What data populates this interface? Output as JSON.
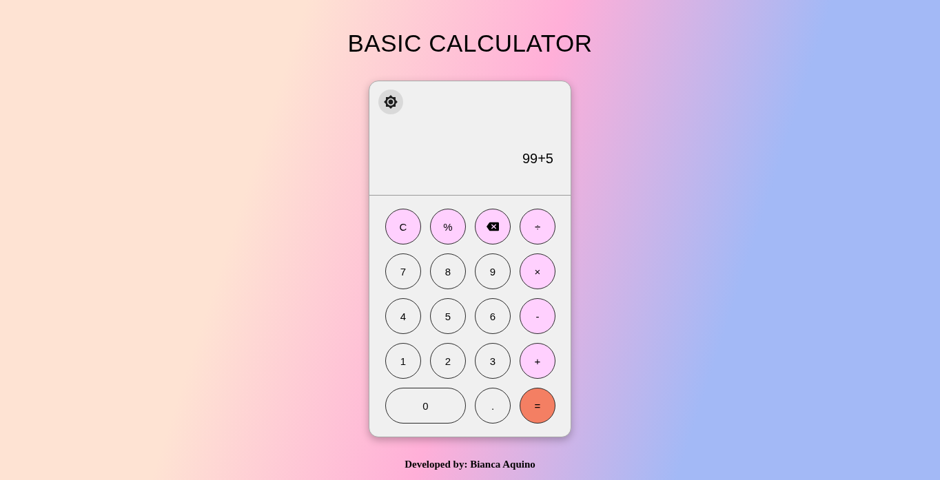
{
  "title": "BASIC CALCULATOR",
  "calculator": {
    "display": {
      "expression": "99+5"
    },
    "keys": [
      {
        "kind": "function",
        "label": "C",
        "wide": false
      },
      {
        "kind": "function",
        "label": "%",
        "wide": false
      },
      {
        "kind": "backspace",
        "wide": false
      },
      {
        "kind": "operator",
        "label": "÷",
        "wide": false
      },
      {
        "kind": "digit",
        "label": "7",
        "wide": false
      },
      {
        "kind": "digit",
        "label": "8",
        "wide": false
      },
      {
        "kind": "digit",
        "label": "9",
        "wide": false
      },
      {
        "kind": "operator",
        "label": "×",
        "wide": false
      },
      {
        "kind": "digit",
        "label": "4",
        "wide": false
      },
      {
        "kind": "digit",
        "label": "5",
        "wide": false
      },
      {
        "kind": "digit",
        "label": "6",
        "wide": false
      },
      {
        "kind": "operator",
        "label": "-",
        "wide": false
      },
      {
        "kind": "digit",
        "label": "1",
        "wide": false
      },
      {
        "kind": "digit",
        "label": "2",
        "wide": false
      },
      {
        "kind": "digit",
        "label": "3",
        "wide": false
      },
      {
        "kind": "operator",
        "label": "+",
        "wide": false
      },
      {
        "kind": "digit",
        "label": "0",
        "wide": true
      },
      {
        "kind": "digit",
        "label": ".",
        "wide": false
      },
      {
        "kind": "equals",
        "label": "=",
        "wide": false
      }
    ]
  },
  "footer": "Developed by: Bianca Aquino"
}
